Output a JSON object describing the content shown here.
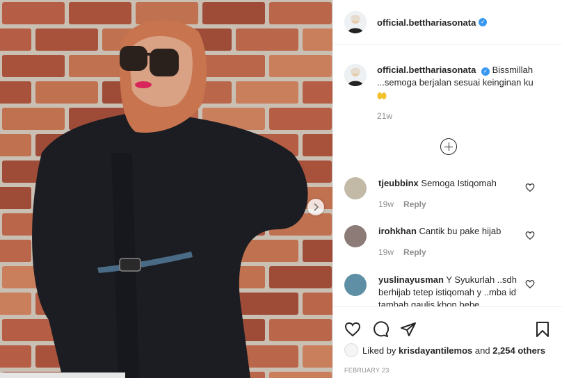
{
  "post": {
    "username": "official.betthariasonata",
    "caption_username": "official.betthariasonata",
    "caption_text": "Bissmillah ...semoga berjalan sesuai keinginan ku",
    "caption_time": "21w",
    "date": "FEBRUARY 23",
    "likes_prefix": "Liked by",
    "likes_user": "krisdayantilemos",
    "likes_and": "and",
    "likes_count": "2,254 others"
  },
  "comments": [
    {
      "username": "tjeubbinx",
      "text": "Semoga Istiqomah",
      "time": "19w",
      "reply": "Reply"
    },
    {
      "username": "irohkhan",
      "text": "Cantik bu pake hijab",
      "time": "19w",
      "reply": "Reply"
    },
    {
      "username": "yuslinayusman",
      "text": "Y Syukurlah ..sdh berhijab tetep istiqomah y ..mba id tambah gaulis kbon bebe",
      "time": "",
      "reply": ""
    }
  ],
  "icons": {
    "like": "heart-icon",
    "comment": "comment-icon",
    "share": "paper-plane-icon",
    "save": "bookmark-icon",
    "next": "chevron-right-icon",
    "load_more": "plus-circle-icon"
  },
  "colors": {
    "verified": "#3897f0",
    "text": "#262626",
    "muted": "#8e8e8e"
  }
}
